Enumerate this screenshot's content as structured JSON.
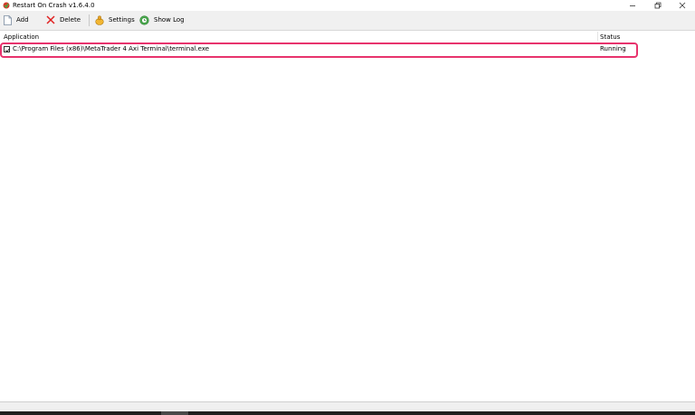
{
  "window": {
    "title": "Restart On Crash v1.6.4.0",
    "icon": "restart-on-crash-app-icon",
    "controls": {
      "minimize": "–",
      "maximize": "❐",
      "close": "✕"
    }
  },
  "toolbar": {
    "add_label": "Add",
    "delete_label": "Delete",
    "settings_label": "Settings",
    "show_log_label": "Show Log",
    "icons": {
      "add": "new-document-icon",
      "delete": "red-x-icon",
      "settings": "settings-icon",
      "show_log": "log-icon"
    }
  },
  "list": {
    "columns": {
      "application": "Application",
      "status": "Status"
    },
    "rows": [
      {
        "checked": true,
        "application": "C:\\Program Files (x86)\\MetaTrader 4 Axi Terminal\\terminal.exe",
        "status": "Running"
      }
    ]
  },
  "colors": {
    "highlight_border": "#e8336d",
    "toolbar_bg": "#f0f0f0",
    "delete_icon": "#e02020"
  }
}
